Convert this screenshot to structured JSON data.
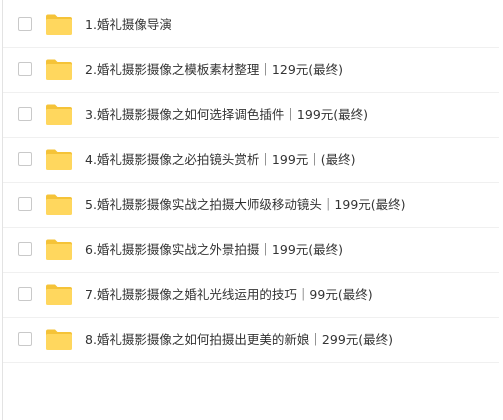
{
  "colors": {
    "folder_body": "#ffd75e",
    "folder_tab": "#f5c338",
    "text": "#333333",
    "checkbox_border": "#c9c9c9"
  },
  "file_list": {
    "icon": "folder-icon",
    "items": [
      {
        "name": "1.婚礼摄像导演",
        "checked": false
      },
      {
        "name": "2.婚礼摄影摄像之模板素材整理｜129元(最终)",
        "checked": false
      },
      {
        "name": "3.婚礼摄影摄像之如何选择调色插件｜199元(最终)",
        "checked": false
      },
      {
        "name": "4.婚礼摄影摄像之必拍镜头赏析｜199元｜(最终)",
        "checked": false
      },
      {
        "name": "5.婚礼摄影摄像实战之拍摄大师级移动镜头｜199元(最终)",
        "checked": false
      },
      {
        "name": "6.婚礼摄影摄像实战之外景拍摄｜199元(最终)",
        "checked": false
      },
      {
        "name": "7.婚礼摄影摄像之婚礼光线运用的技巧｜99元(最终)",
        "checked": false
      },
      {
        "name": "8.婚礼摄影摄像之如何拍摄出更美的新娘｜299元(最终)",
        "checked": false
      }
    ]
  }
}
